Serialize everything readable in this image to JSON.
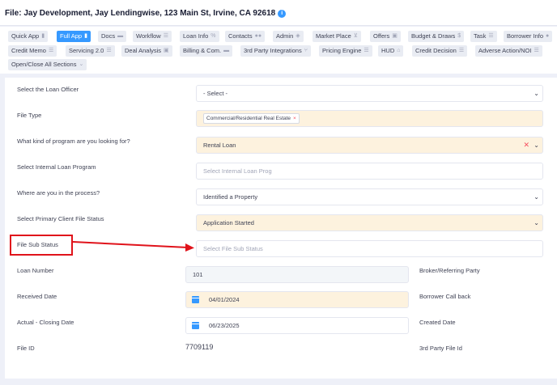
{
  "header": {
    "file_title": "File: Jay Development, Jay Lendingwise, 123 Main St, Irvine, CA 92618",
    "info_icon": "i"
  },
  "tabs": {
    "row1": [
      {
        "label": "Quick App",
        "icon": "file-icon",
        "glyph": "▮"
      },
      {
        "label": "Full App",
        "icon": "file-icon",
        "glyph": "▮",
        "active": true
      },
      {
        "label": "Docs",
        "icon": "folder-icon",
        "glyph": "▬"
      },
      {
        "label": "Workflow",
        "icon": "list-icon",
        "glyph": "☰"
      },
      {
        "label": "Loan Info",
        "icon": "percent-icon",
        "glyph": "%"
      },
      {
        "label": "Contacts",
        "icon": "users-icon",
        "glyph": "●●"
      },
      {
        "label": "Admin",
        "icon": "shield-icon",
        "glyph": "◈"
      },
      {
        "label": "Market Place",
        "icon": "cart-icon",
        "glyph": "⊻"
      },
      {
        "label": "Offers",
        "icon": "gift-icon",
        "glyph": "▣"
      },
      {
        "label": "Budget & Draws",
        "icon": "dollar-icon",
        "glyph": "$"
      },
      {
        "label": "Task",
        "icon": "list-icon",
        "glyph": "☰"
      },
      {
        "label": "Borrower Info",
        "icon": "user-icon",
        "glyph": "●"
      }
    ],
    "row2": [
      {
        "label": "Credit Memo",
        "icon": "list-icon",
        "glyph": "☰"
      },
      {
        "label": "Servicing 2.0",
        "icon": "list-icon",
        "glyph": "☰"
      },
      {
        "label": "Deal Analysis",
        "icon": "gift-icon",
        "glyph": "▣"
      },
      {
        "label": "Billing & Com.",
        "icon": "card-icon",
        "glyph": "▬"
      },
      {
        "label": "3rd Party Integrations",
        "icon": "branch-icon",
        "glyph": "⑂"
      },
      {
        "label": "Pricing Engine",
        "icon": "list-icon",
        "glyph": "☰"
      },
      {
        "label": "HUD",
        "icon": "home-icon",
        "glyph": "⌂"
      },
      {
        "label": "Credit Decision",
        "icon": "list-icon",
        "glyph": "☰"
      },
      {
        "label": "Adverse Action/NOI",
        "icon": "list-icon",
        "glyph": "☰"
      }
    ],
    "sections_toggle": "Open/Close All Sections",
    "sections_chevron": "⌄"
  },
  "form": {
    "loan_officer": {
      "label": "Select the Loan Officer",
      "value": "- Select -"
    },
    "file_type": {
      "label": "File Type",
      "chip": "Commercial/Residential Real Estate",
      "chip_x": "×"
    },
    "program": {
      "label": "What kind of program are you looking for?",
      "value": "Rental Loan",
      "clear": "✕"
    },
    "internal_program": {
      "label": "Select Internal Loan Program",
      "placeholder": "Select Internal Loan Prog"
    },
    "process": {
      "label": "Where are you in the process?",
      "value": "Identified a Property"
    },
    "primary_status": {
      "label": "Select Primary Client File Status",
      "value": "Application Started"
    },
    "sub_status": {
      "label": "File Sub Status",
      "placeholder": "Select File Sub Status"
    },
    "loan_number": {
      "label": "Loan Number",
      "value": "101"
    },
    "broker": {
      "label": "Broker/Referring Party"
    },
    "received_date": {
      "label": "Received Date",
      "value": "04/01/2024"
    },
    "borrower_callback": {
      "label": "Borrower Call back"
    },
    "closing_date": {
      "label": "Actual - Closing Date",
      "value": "06/23/2025"
    },
    "created_date": {
      "label": "Created Date"
    },
    "file_id": {
      "label": "File ID",
      "value": "7709119"
    },
    "third_party_id": {
      "label": "3rd Party File Id"
    }
  },
  "chevron": "⌄",
  "colors": {
    "accent": "#3699ff",
    "highlight": "#e0131b",
    "yellow_field": "#fdf2de"
  }
}
